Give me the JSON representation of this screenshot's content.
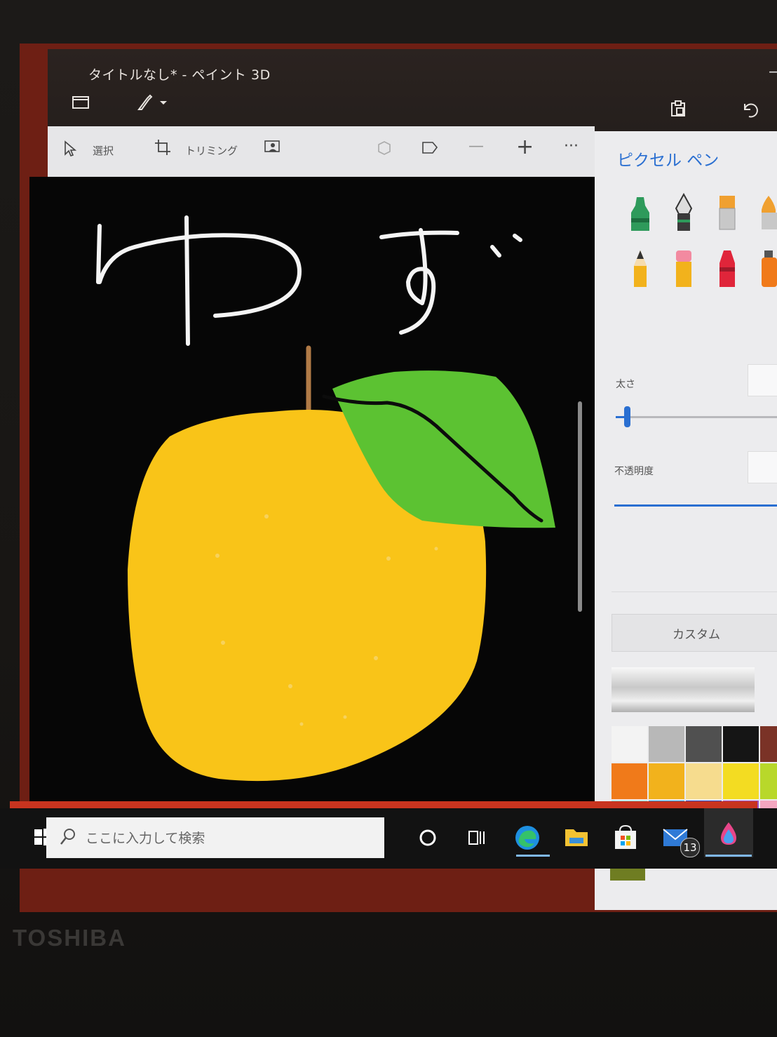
{
  "window": {
    "title": "タイトルなし* - ペイント 3D",
    "minimize_label": "—"
  },
  "toolbar": {
    "select_label": "選択",
    "crop_label": "トリミング",
    "zoom_out_label": "—",
    "zoom_in_label": "+",
    "more_label": "···"
  },
  "canvas": {
    "handwritten_text": "ゆず"
  },
  "panel": {
    "title": "ピクセル ペン",
    "thickness_label": "太さ",
    "thickness_level": 0.08,
    "opacity_label": "不透明度",
    "opacity_level": 1.0,
    "custom_label": "カスタム",
    "add_color_label": "+",
    "current_color": "#6f7d22",
    "palette": [
      [
        "#f3f3f3",
        "#b8b8b8",
        "#505050",
        "#151515",
        "#7a3226"
      ],
      [
        "#f07a1a",
        "#f2b21c",
        "#f6dc8e",
        "#f3dc22",
        "#b8d82a"
      ],
      [
        "#8ee9e4",
        "#1f9be0",
        "#2849c8",
        "#a04fc0",
        "#f4a6c0"
      ]
    ]
  },
  "taskbar": {
    "search_placeholder": "ここに入力して検索",
    "mail_badge": "13"
  },
  "bezel": {
    "brand": "TOSHIBA"
  },
  "colors": {
    "accent": "#c8341f",
    "panel_title": "#2a6fd1",
    "yuzu": "#f9c418",
    "leaf": "#5cc232"
  }
}
